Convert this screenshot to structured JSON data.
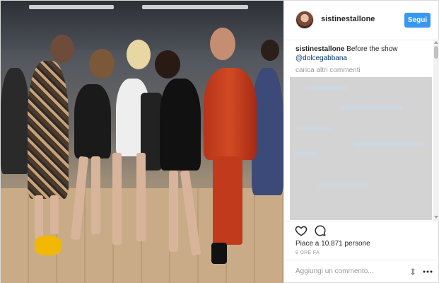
{
  "post": {
    "header": {
      "username": "sistinestallone",
      "follow_label": "Segui"
    },
    "caption": {
      "username": "sistinestallone",
      "text": "Before the show",
      "mention": "@dolcegabbana"
    },
    "load_more_label": "carica altri commenti",
    "likes_text": "Piace a 10.871 persone",
    "timestamp": "9 ORE FA",
    "add_comment_placeholder": "Aggiungi un commento...",
    "icons": {
      "like": "heart-icon",
      "comment": "comment-icon",
      "more": "more-options-icon",
      "spinner": "loading-icon"
    },
    "colors": {
      "follow_button": "#3897f0",
      "mention": "#003569",
      "muted": "#999999"
    }
  }
}
